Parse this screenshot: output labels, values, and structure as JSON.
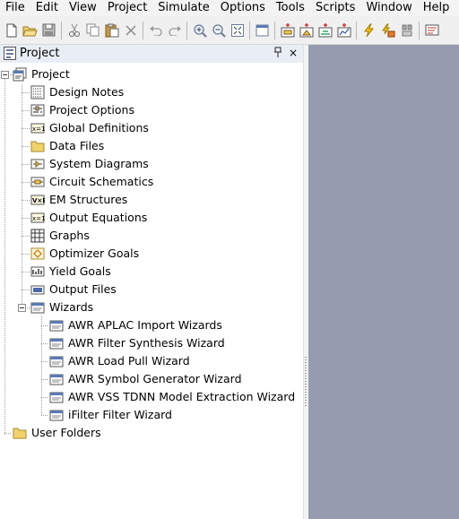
{
  "menubar": {
    "items": [
      "File",
      "Edit",
      "View",
      "Project",
      "Simulate",
      "Options",
      "Tools",
      "Scripts",
      "Window",
      "Help"
    ]
  },
  "toolbar": {
    "buttons": [
      "new-icon",
      "open-icon",
      "save-icon",
      "cut-icon",
      "copy-icon",
      "paste-icon",
      "delete-icon",
      "undo-icon",
      "redo-icon",
      "zoom-in-icon",
      "zoom-out-icon",
      "zoom-fit-icon",
      "window-icon",
      "add-schematic-icon",
      "add-system-icon",
      "add-em-icon",
      "add-graph-icon",
      "simulate-icon",
      "tune-icon",
      "stop-icon",
      "output-icon"
    ]
  },
  "panel": {
    "title": "Project",
    "pin_glyph": "P",
    "close_glyph": "×"
  },
  "tree": {
    "root": "Project",
    "items": [
      {
        "label": "Design Notes",
        "icon": "notes-icon"
      },
      {
        "label": "Project Options",
        "icon": "options-icon"
      },
      {
        "label": "Global Definitions",
        "icon": "definitions-icon"
      },
      {
        "label": "Data Files",
        "icon": "folder-icon"
      },
      {
        "label": "System Diagrams",
        "icon": "system-diagram-icon"
      },
      {
        "label": "Circuit Schematics",
        "icon": "schematic-icon"
      },
      {
        "label": "EM Structures",
        "icon": "em-structure-icon"
      },
      {
        "label": "Output Equations",
        "icon": "equations-icon"
      },
      {
        "label": "Graphs",
        "icon": "graph-icon"
      },
      {
        "label": "Optimizer Goals",
        "icon": "optimizer-icon"
      },
      {
        "label": "Yield Goals",
        "icon": "yield-icon"
      },
      {
        "label": "Output Files",
        "icon": "output-files-icon"
      },
      {
        "label": "Wizards",
        "icon": "wizard-icon"
      }
    ],
    "wizards": [
      "AWR APLAC Import Wizards",
      "AWR Filter Synthesis Wizard",
      "AWR Load Pull Wizard",
      "AWR Symbol Generator Wizard",
      "AWR VSS TDNN Model Extraction Wizard",
      "iFilter Filter Wizard"
    ],
    "user_folders": "User Folders"
  },
  "colors": {
    "mdi_background": "#949cad",
    "panel_header": "#e9eef6"
  }
}
